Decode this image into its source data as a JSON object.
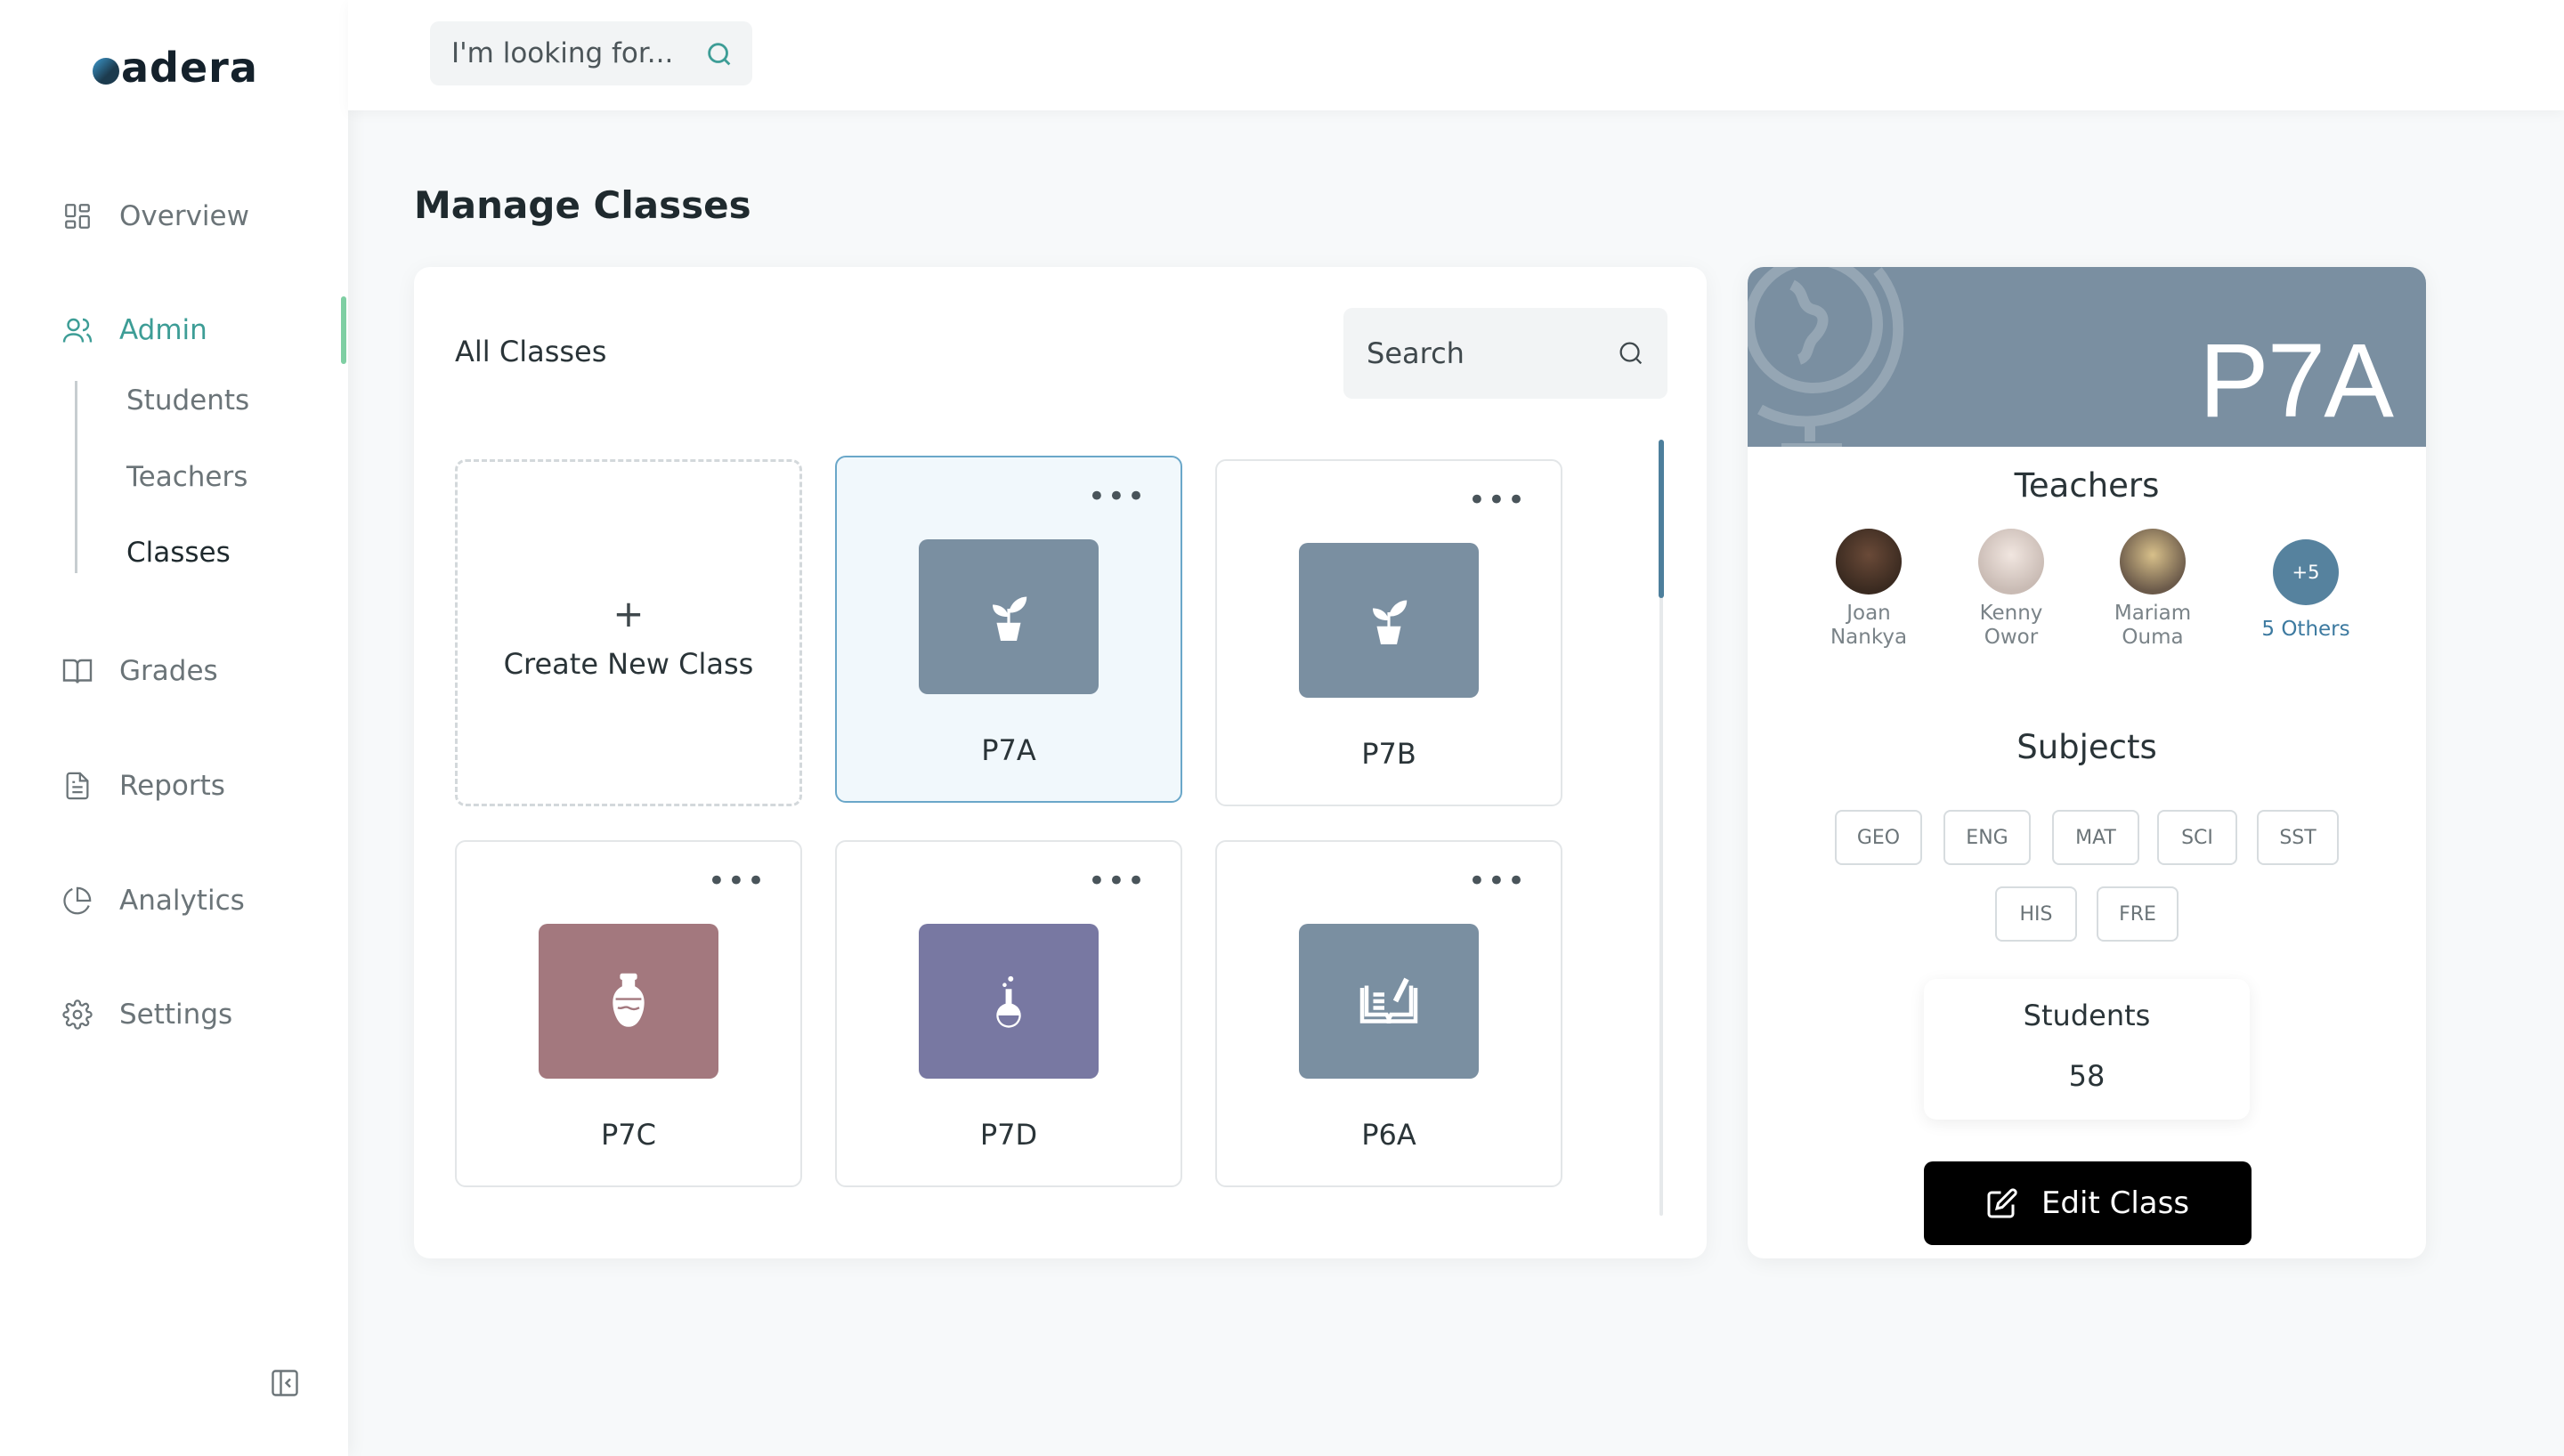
{
  "app": {
    "logo_text": "adera"
  },
  "sidebar": {
    "items": [
      {
        "label": "Overview",
        "icon": "grid-icon"
      },
      {
        "label": "Admin",
        "icon": "users-icon"
      },
      {
        "label": "Grades",
        "icon": "book-icon"
      },
      {
        "label": "Reports",
        "icon": "document-icon"
      },
      {
        "label": "Analytics",
        "icon": "pie-chart-icon"
      },
      {
        "label": "Settings",
        "icon": "gear-icon"
      }
    ],
    "admin_sub": [
      {
        "label": "Students"
      },
      {
        "label": "Teachers"
      },
      {
        "label": "Classes"
      }
    ],
    "active_item": "Admin",
    "current_sub": "Classes"
  },
  "header": {
    "search_placeholder": "I'm looking for..."
  },
  "main": {
    "title": "Manage Classes",
    "panel_title": "All Classes",
    "search_placeholder": "Search",
    "create_label": "Create New Class",
    "create_plus": "+",
    "tile_menu": "•••",
    "classes": [
      {
        "name": "P7A",
        "color": "#7a8fa1",
        "icon": "plant-icon",
        "selected": true
      },
      {
        "name": "P7B",
        "color": "#7a8fa1",
        "icon": "plant-icon",
        "selected": false
      },
      {
        "name": "P7C",
        "color": "#a3787e",
        "icon": "vase-icon",
        "selected": false
      },
      {
        "name": "P7D",
        "color": "#7878a2",
        "icon": "flask-icon",
        "selected": false
      },
      {
        "name": "P6A",
        "color": "#7a8fa1",
        "icon": "open-book-icon",
        "selected": false
      }
    ]
  },
  "detail": {
    "class_name": "P7A",
    "banner_color": "#7a8fa1",
    "teachers_title": "Teachers",
    "teachers": [
      {
        "first": "Joan",
        "last": "Nankya"
      },
      {
        "first": "Kenny",
        "last": "Owor"
      },
      {
        "first": "Mariam",
        "last": "Ouma"
      }
    ],
    "others_badge": "+5",
    "others_label": "5 Others",
    "subjects_title": "Subjects",
    "subjects": [
      "GEO",
      "ENG",
      "MAT",
      "SCI",
      "SST",
      "HIS",
      "FRE"
    ],
    "students_label": "Students",
    "students_count": "58",
    "edit_label": "Edit Class"
  },
  "colors": {
    "accent": "#3d9d96",
    "active_bar": "#7fcfa3",
    "button": "#000000"
  }
}
